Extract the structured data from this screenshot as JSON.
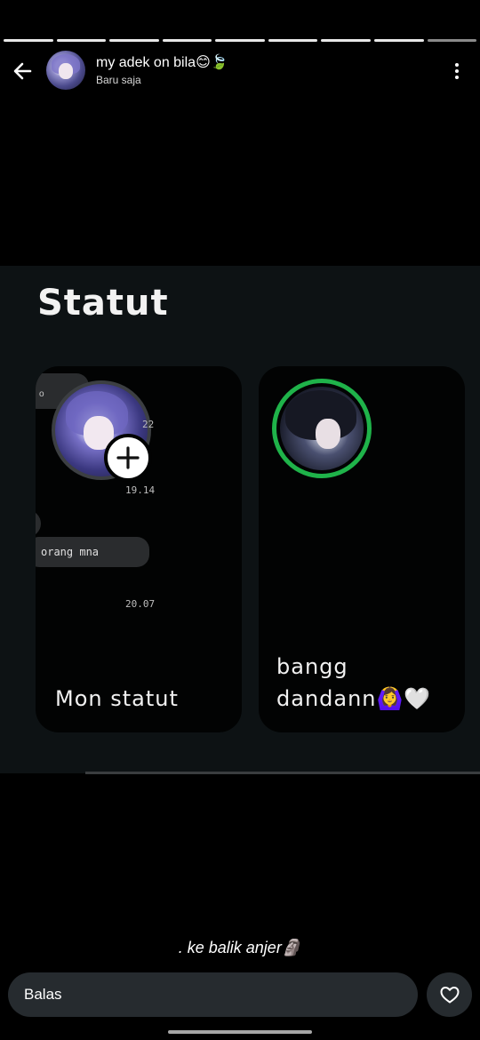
{
  "progress": {
    "segments": 9,
    "active_index": 8
  },
  "header": {
    "title": "my adek on bila😊🍃",
    "subtitle": "Baru saja",
    "back_icon": "arrow-left-icon",
    "menu_icon": "more-vertical-icon"
  },
  "story": {
    "heading": "Statut",
    "my_status": {
      "label": "Mon statut",
      "chat_preview_text": "orang mna",
      "timestamps": [
        "22",
        "19.14",
        "20.07"
      ],
      "small_text": "o",
      "add_icon": "plus-icon"
    },
    "contact_status": {
      "label_line1": "bangg",
      "label_line2": "dandann🙆‍♀️🤍",
      "ring_color": "#1fb34a"
    },
    "caption": ". ke balik anjer🗿"
  },
  "reply": {
    "placeholder": "Balas",
    "heart_icon": "heart-outline-icon"
  },
  "colors": {
    "background": "#000000",
    "panel": "#0d1214",
    "reply_bar": "#262b2f",
    "accent_green": "#1fb34a"
  }
}
